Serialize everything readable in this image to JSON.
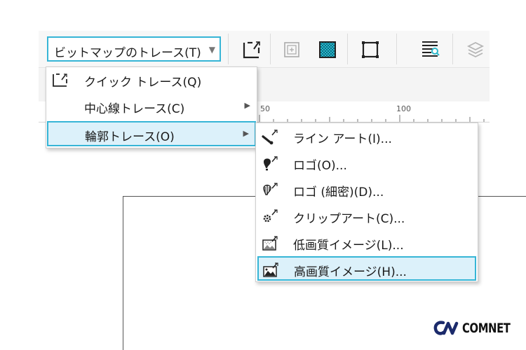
{
  "toolbar": {
    "trace_dropdown_label": "ビットマップのトレース(T)",
    "icons": [
      "cut-crop-icon",
      "bitmap-frame-icon",
      "checker-fill-icon",
      "frame-select-icon",
      "align-text-icon",
      "layers-icon"
    ]
  },
  "ruler": {
    "marks": [
      "50",
      "100"
    ]
  },
  "trace_menu": {
    "items": [
      {
        "label": "クイック トレース(Q)",
        "icon": "quick-trace-icon",
        "has_submenu": false,
        "highlighted": false
      },
      {
        "label": "中心線トレース(C)",
        "icon": "",
        "has_submenu": true,
        "highlighted": false
      },
      {
        "label": "輪郭トレース(O)",
        "icon": "",
        "has_submenu": true,
        "highlighted": true
      }
    ]
  },
  "outline_submenu": {
    "items": [
      {
        "label": "ライン アート(I)...",
        "icon": "line-art-icon",
        "highlighted": false
      },
      {
        "label": "ロゴ(O)...",
        "icon": "logo-icon",
        "highlighted": false
      },
      {
        "label": "ロゴ (細密)(D)...",
        "icon": "logo-detail-icon",
        "highlighted": false
      },
      {
        "label": "クリップアート(C)...",
        "icon": "clipart-icon",
        "highlighted": false
      },
      {
        "label": "低画質イメージ(L)...",
        "icon": "low-quality-image-icon",
        "highlighted": false
      },
      {
        "label": "高画質イメージ(H)...",
        "icon": "high-quality-image-icon",
        "highlighted": true
      }
    ]
  },
  "brand": {
    "name": "COMNET"
  },
  "colors": {
    "accent_border": "#36b5d6",
    "highlight_bg": "#dcf1fa",
    "checker_fill": "#2bb7c9"
  }
}
